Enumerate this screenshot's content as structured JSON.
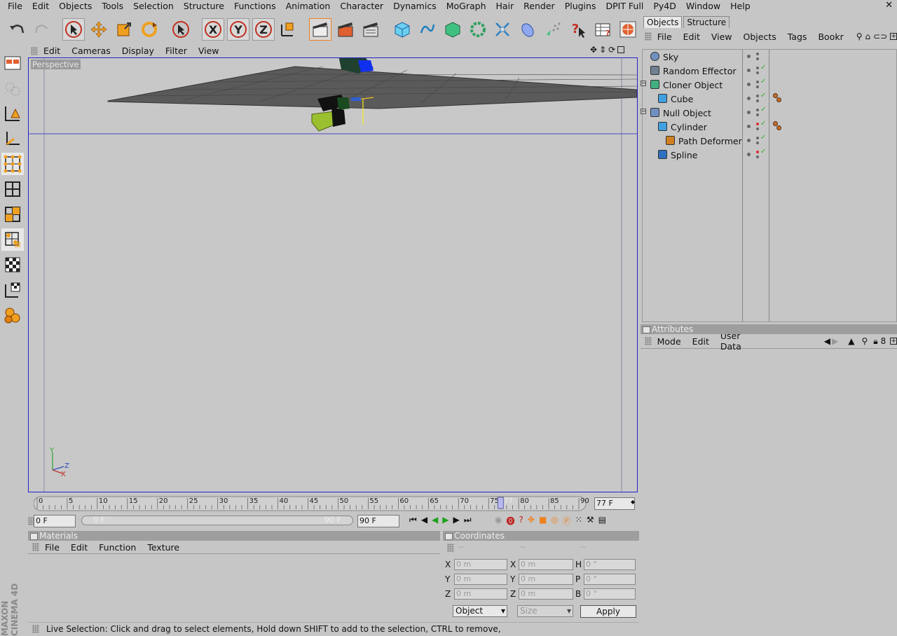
{
  "menubar": [
    "File",
    "Edit",
    "Objects",
    "Tools",
    "Selection",
    "Structure",
    "Functions",
    "Animation",
    "Character",
    "Dynamics",
    "MoGraph",
    "Hair",
    "Render",
    "Plugins",
    "DPIT Full",
    "Py4D",
    "Window",
    "Help"
  ],
  "viewport": {
    "menu": [
      "Edit",
      "Cameras",
      "Display",
      "Filter",
      "View"
    ],
    "label": "Perspective",
    "axes": {
      "y": "Y",
      "z": "Z",
      "x": "X"
    }
  },
  "timeline": {
    "ticks": [
      "0",
      "5",
      "10",
      "15",
      "20",
      "25",
      "30",
      "35",
      "40",
      "45",
      "50",
      "55",
      "60",
      "65",
      "70",
      "75",
      "80",
      "85",
      "90"
    ],
    "current_marker": "77",
    "current_frame": "77 F",
    "start_field": "0 F",
    "range_start": "0 F",
    "range_end": "90 F",
    "end_field": "90 F"
  },
  "materials": {
    "title": "Materials",
    "menu": [
      "File",
      "Edit",
      "Function",
      "Texture"
    ]
  },
  "coordinates": {
    "title": "Coordinates",
    "headers": [
      "--",
      "--",
      "--"
    ],
    "rows": [
      {
        "l1": "X",
        "v1": "0 m",
        "l2": "X",
        "v2": "0 m",
        "l3": "H",
        "v3": "0 °"
      },
      {
        "l1": "Y",
        "v1": "0 m",
        "l2": "Y",
        "v2": "0 m",
        "l3": "P",
        "v3": "0 °"
      },
      {
        "l1": "Z",
        "v1": "0 m",
        "l2": "Z",
        "v2": "0 m",
        "l3": "B",
        "v3": "0 °"
      }
    ],
    "mode_select": "Object",
    "size_select": "Size",
    "apply": "Apply"
  },
  "status": "Live Selection: Click and drag to select elements, Hold down SHIFT to add to the selection, CTRL to remove,",
  "objects_panel": {
    "tabs": [
      "Objects",
      "Structure"
    ],
    "menu": [
      "File",
      "Edit",
      "View",
      "Objects",
      "Tags",
      "Bookr"
    ],
    "items": [
      {
        "name": "Sky",
        "indent": 1
      },
      {
        "name": "Random Effector",
        "indent": 1
      },
      {
        "name": "Cloner Object",
        "indent": 1
      },
      {
        "name": "Cube",
        "indent": 2
      },
      {
        "name": "Null Object",
        "indent": 1
      },
      {
        "name": "Cylinder",
        "indent": 2
      },
      {
        "name": "Path Deformer",
        "indent": 3
      },
      {
        "name": "Spline",
        "indent": 2
      }
    ]
  },
  "attributes_panel": {
    "title": "Attributes",
    "menu": [
      "Mode",
      "Edit",
      "User Data"
    ]
  },
  "brand": {
    "line1": "MAXON",
    "line2": "CINEMA 4D"
  },
  "colors": {
    "accent_orange": "#f08020",
    "viewport_border": "#2323c8",
    "mograph_green": "#30a060"
  }
}
